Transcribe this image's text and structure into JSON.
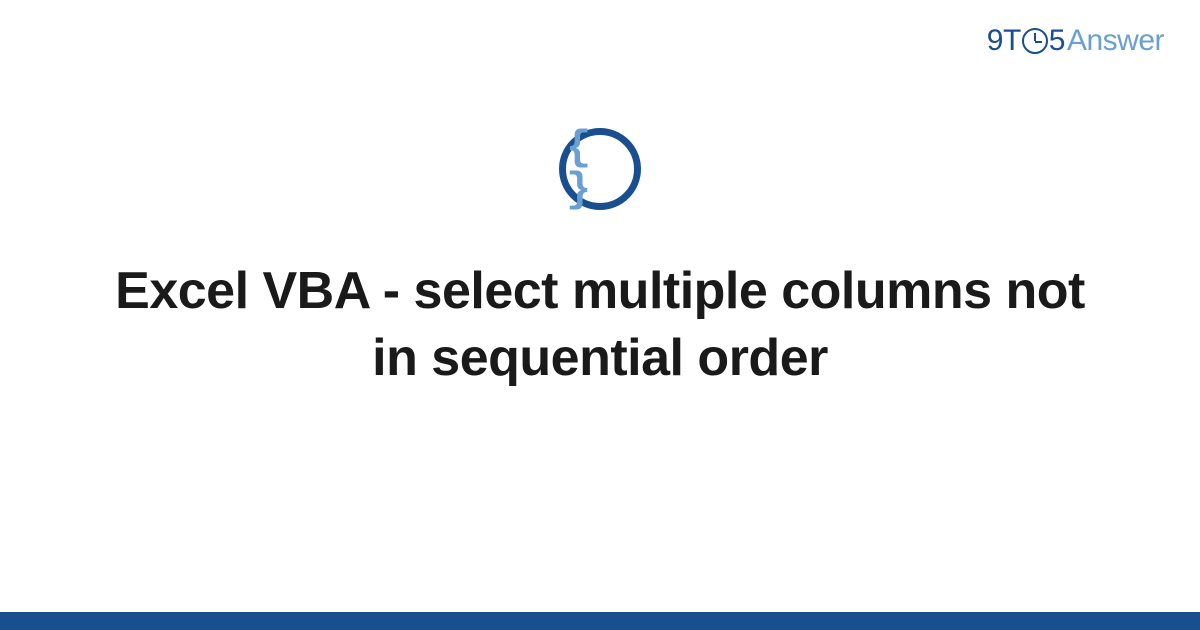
{
  "logo": {
    "nine": "9",
    "t": "T",
    "five": "5",
    "answer": "Answer"
  },
  "icon": {
    "braces": "{ }"
  },
  "title": "Excel VBA - select multiple columns not in sequential order",
  "colors": {
    "primary": "#1a4f8f",
    "secondary": "#6a9fd4",
    "text": "#1a1a1a"
  }
}
